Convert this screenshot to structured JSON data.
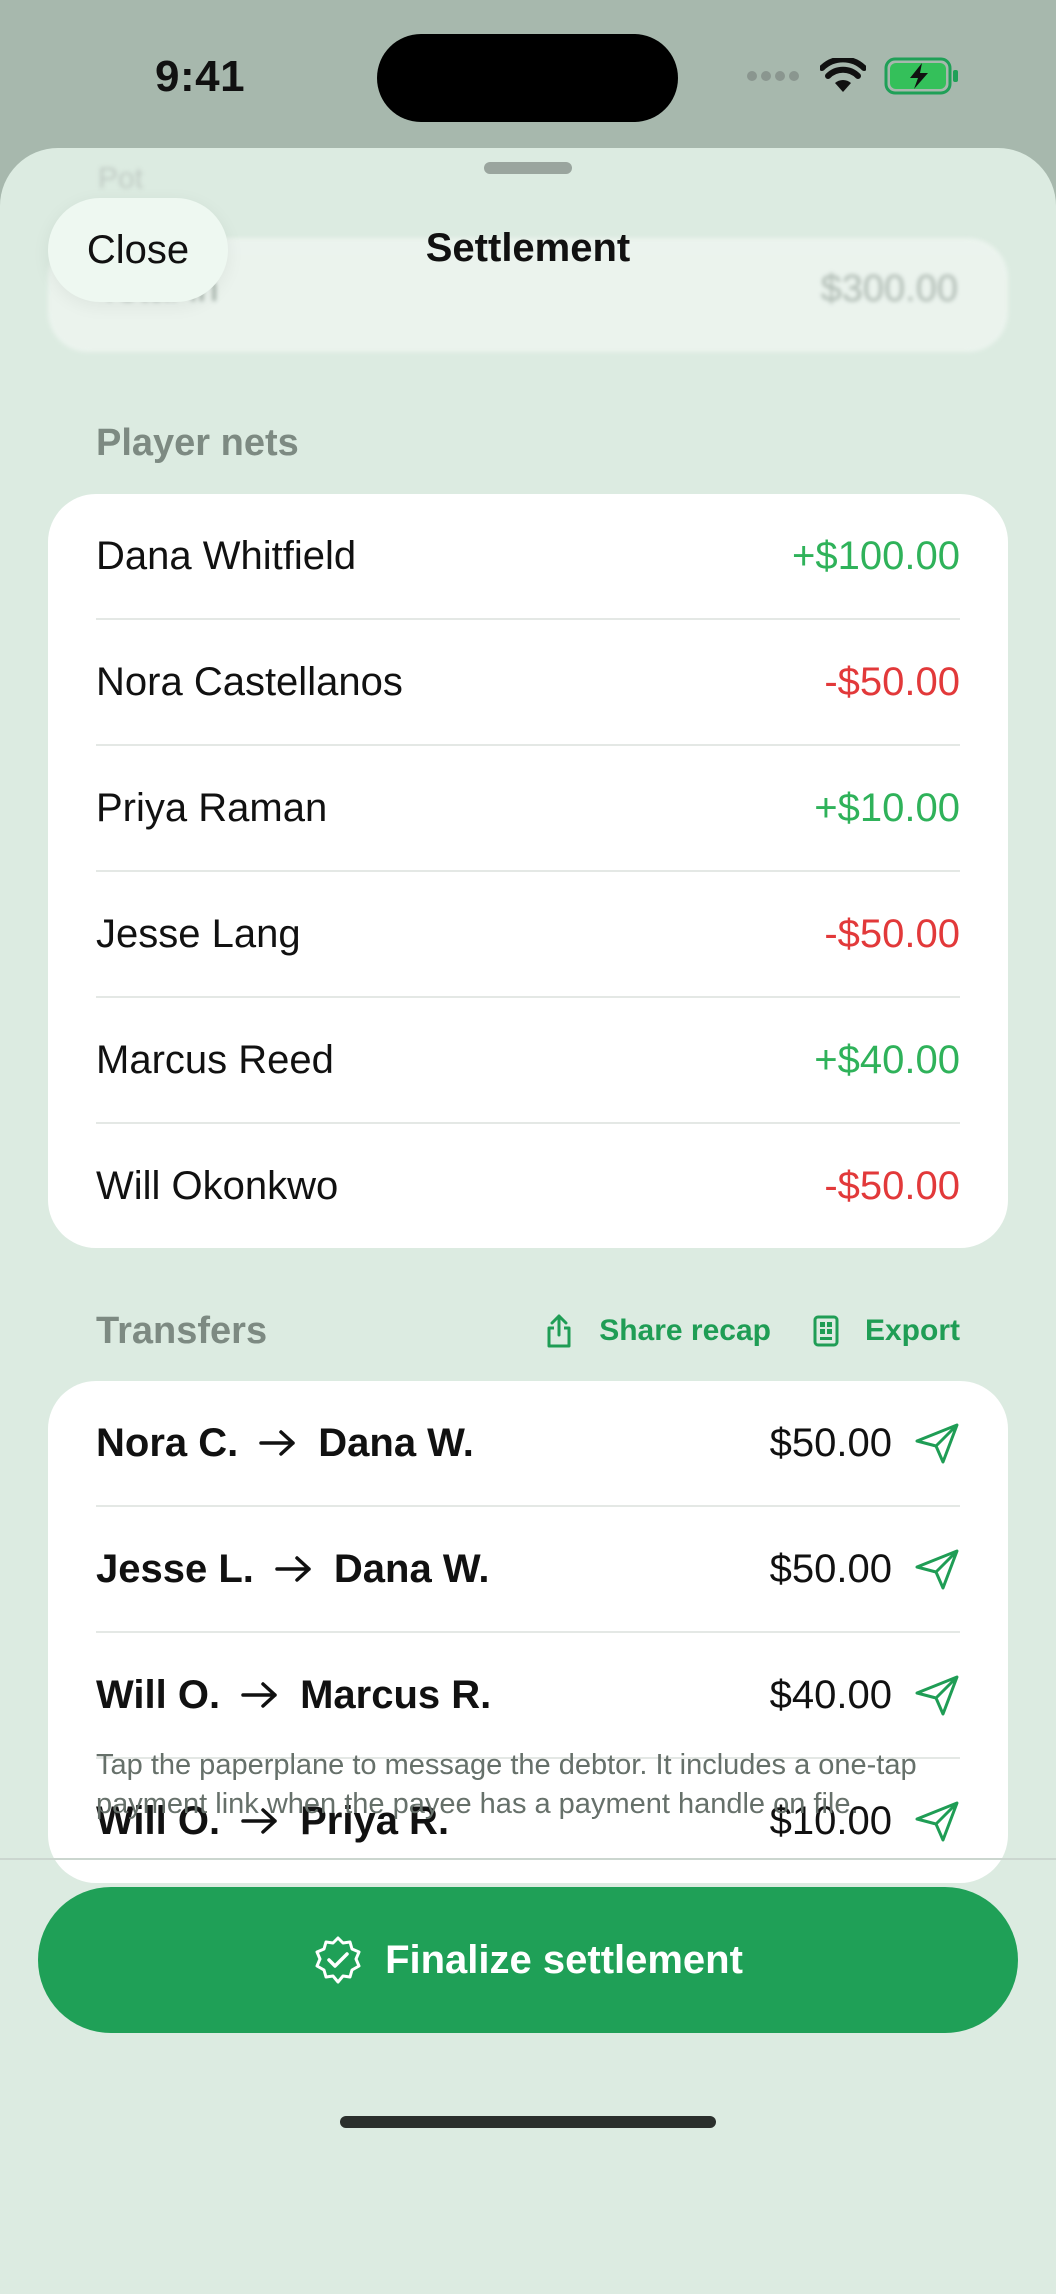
{
  "status": {
    "time": "9:41"
  },
  "nav": {
    "close_label": "Close",
    "title": "Settlement"
  },
  "background": {
    "top_label": "Pot",
    "total_label": "Total in",
    "total_value": "$300.00"
  },
  "player_nets": {
    "title": "Player nets",
    "rows": [
      {
        "name": "Dana Whitfield",
        "net": "+$100.00",
        "sign": "positive"
      },
      {
        "name": "Nora Castellanos",
        "net": "-$50.00",
        "sign": "negative"
      },
      {
        "name": "Priya Raman",
        "net": "+$10.00",
        "sign": "positive"
      },
      {
        "name": "Jesse Lang",
        "net": "-$50.00",
        "sign": "negative"
      },
      {
        "name": "Marcus Reed",
        "net": "+$40.00",
        "sign": "positive"
      },
      {
        "name": "Will Okonkwo",
        "net": "-$50.00",
        "sign": "negative"
      }
    ]
  },
  "transfers": {
    "title": "Transfers",
    "share_label": "Share recap",
    "export_label": "Export",
    "rows": [
      {
        "from": "Nora C.",
        "to": "Dana W.",
        "amount": "$50.00"
      },
      {
        "from": "Jesse L.",
        "to": "Dana W.",
        "amount": "$50.00"
      },
      {
        "from": "Will O.",
        "to": "Marcus R.",
        "amount": "$40.00"
      },
      {
        "from": "Will O.",
        "to": "Priya R.",
        "amount": "$10.00"
      }
    ],
    "footnote": "Tap the paperplane to message the debtor. It includes a one-tap payment link when the payee has a payment handle on file."
  },
  "finalize_label": "Finalize settlement",
  "colors": {
    "positive": "#2fb25a",
    "negative": "#e2393a",
    "accent": "#1fa057",
    "sheet": "#dcebe1"
  },
  "icons": [
    "wifi-icon",
    "battery-charging-icon",
    "share-icon",
    "export-icon",
    "arrow-right-icon",
    "paperplane-icon",
    "checkmark-seal-icon"
  ]
}
